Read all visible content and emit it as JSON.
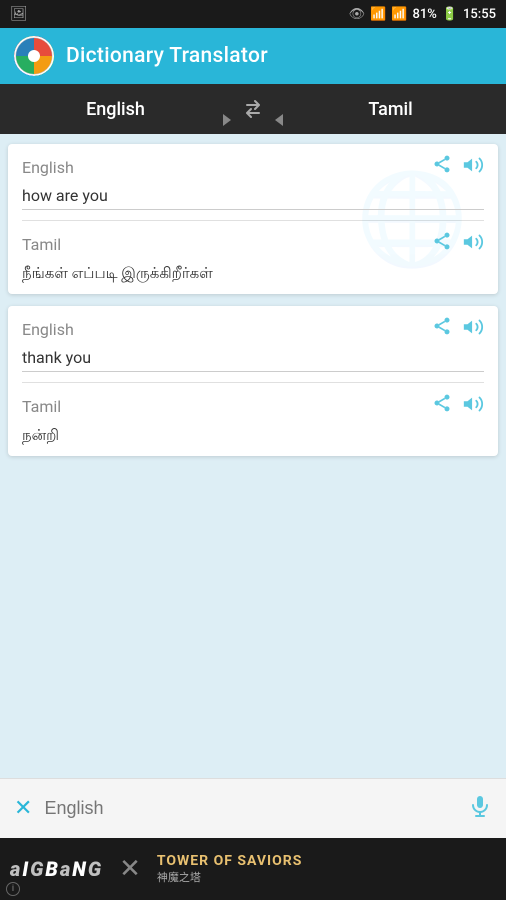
{
  "statusBar": {
    "battery": "81%",
    "time": "15:55"
  },
  "header": {
    "title": "Dictionary Translator"
  },
  "langBar": {
    "sourceLanguage": "English",
    "targetLanguage": "Tamil",
    "swapIcon": "⟳"
  },
  "cards": [
    {
      "id": "card-1",
      "sourceLang": "English",
      "sourceText": "how are you",
      "targetLang": "Tamil",
      "targetText": "நீங்கள் எப்படி இருக்கிறீர்கள்"
    },
    {
      "id": "card-2",
      "sourceLang": "English",
      "sourceText": "thank you",
      "targetLang": "Tamil",
      "targetText": "நன்றி"
    }
  ],
  "searchBar": {
    "placeholder": "English",
    "clearIcon": "✕",
    "micIcon": "🎤"
  },
  "adBanner": {
    "logoText": "aIGBaNG",
    "xText": "X",
    "titleText": "TOWER OF SAVIORS",
    "subtitleText": "神魔之塔",
    "infoLabel": "ⓘ"
  }
}
